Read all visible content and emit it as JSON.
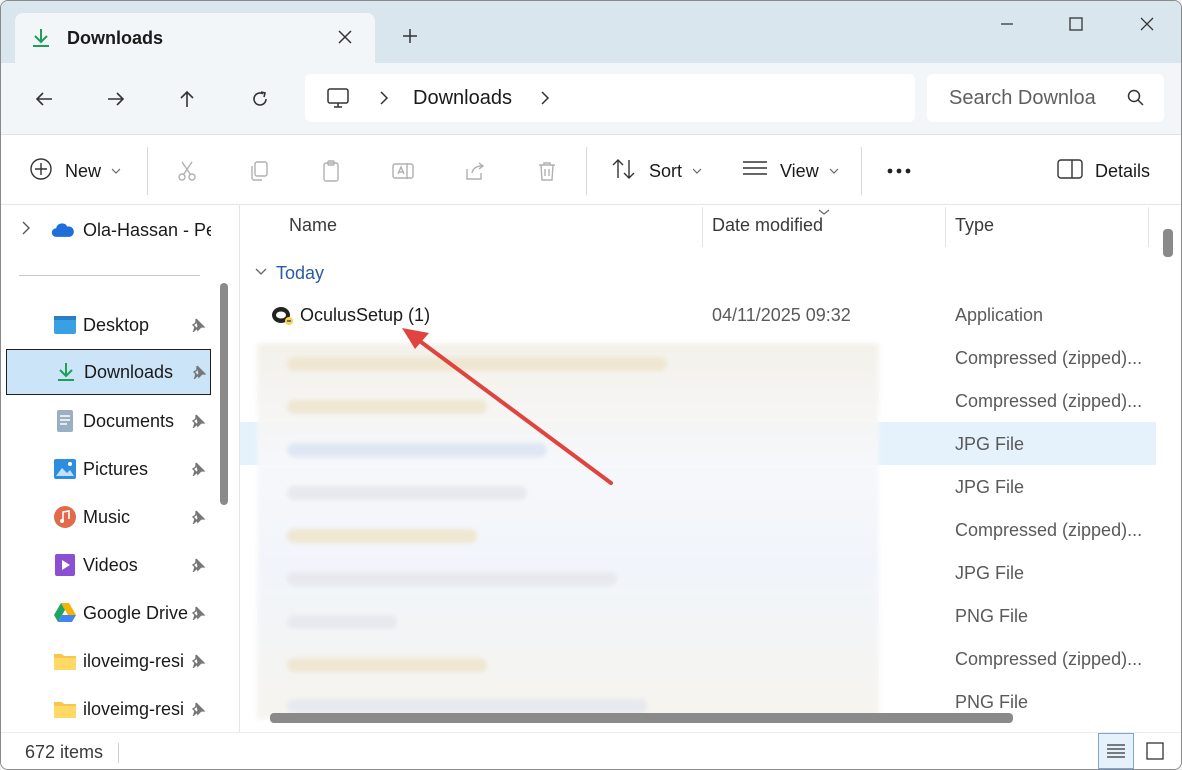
{
  "tab": {
    "title": "Downloads"
  },
  "address": {
    "crumb": "Downloads"
  },
  "search": {
    "placeholder": "Search Downloa"
  },
  "toolbar": {
    "new_label": "New",
    "sort_label": "Sort",
    "view_label": "View",
    "details_label": "Details"
  },
  "sidebar": {
    "cloud": {
      "label": "Ola-Hassan - Per"
    },
    "items": [
      {
        "label": "Desktop",
        "icon": "desktop-icon"
      },
      {
        "label": "Downloads",
        "icon": "download-icon"
      },
      {
        "label": "Documents",
        "icon": "document-icon"
      },
      {
        "label": "Pictures",
        "icon": "picture-icon"
      },
      {
        "label": "Music",
        "icon": "music-icon"
      },
      {
        "label": "Videos",
        "icon": "video-icon"
      },
      {
        "label": "Google Drive",
        "icon": "google-drive-icon"
      },
      {
        "label": "iloveimg-resi",
        "icon": "folder-icon"
      },
      {
        "label": "iloveimg-resi",
        "icon": "folder-icon"
      }
    ]
  },
  "columns": {
    "name": "Name",
    "date": "Date modified",
    "type": "Type"
  },
  "group": {
    "label": "Today"
  },
  "files": [
    {
      "name": "OculusSetup (1)",
      "date": "04/11/2025 09:32",
      "type": "Application"
    },
    {
      "name": "",
      "date": "",
      "type": "Compressed (zipped)..."
    },
    {
      "name": "",
      "date": "",
      "type": "Compressed (zipped)..."
    },
    {
      "name": "",
      "date": "",
      "type": "JPG File"
    },
    {
      "name": "",
      "date": "",
      "type": "JPG File"
    },
    {
      "name": "",
      "date": "",
      "type": "Compressed (zipped)..."
    },
    {
      "name": "",
      "date": "",
      "type": "JPG File"
    },
    {
      "name": "",
      "date": "",
      "type": "PNG File"
    },
    {
      "name": "",
      "date": "",
      "type": "Compressed (zipped)..."
    },
    {
      "name": "",
      "date": "",
      "type": "PNG File"
    }
  ],
  "status": {
    "count": "672 items"
  },
  "colors": {
    "accent": "#0067c0",
    "selection": "#cce4f7",
    "arrow": "#e0443e"
  }
}
